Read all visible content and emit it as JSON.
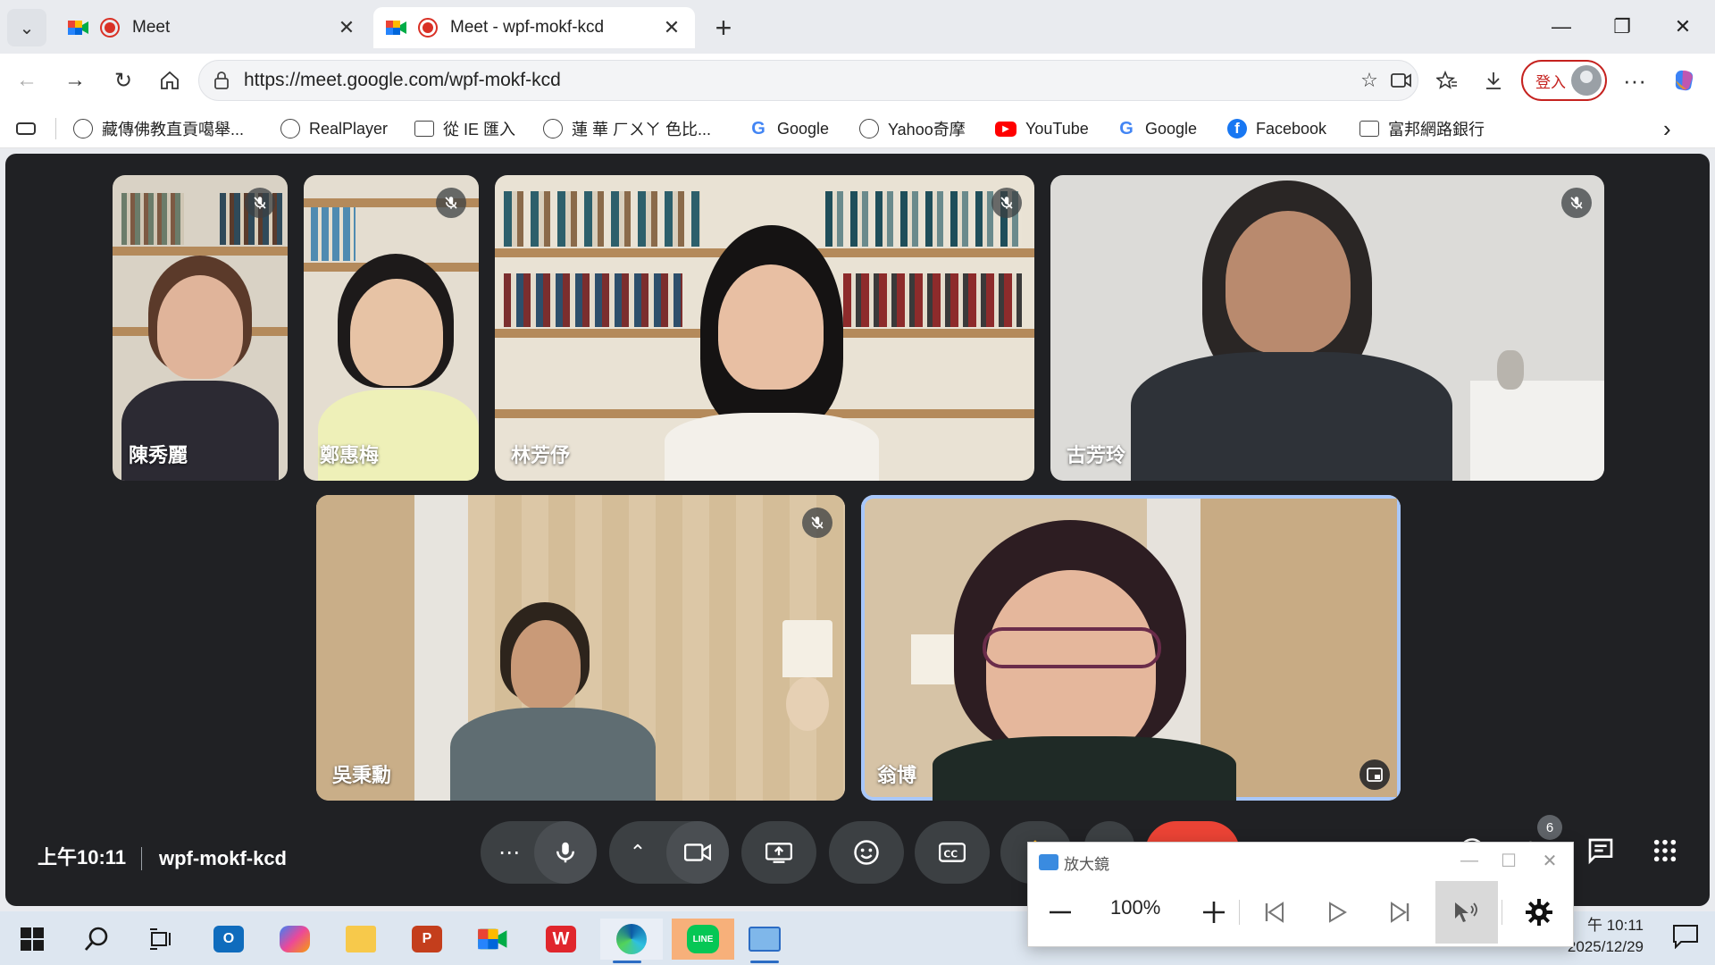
{
  "tabs": [
    {
      "title": "Meet",
      "active": false
    },
    {
      "title": "Meet - wpf-mokf-kcd",
      "active": true
    }
  ],
  "address_bar": {
    "url": "https://meet.google.com/wpf-mokf-kcd"
  },
  "profile": {
    "login_label": "登入"
  },
  "bookmarks": [
    {
      "label": "藏傳佛教直貢噶舉...",
      "icon": "globe-icon"
    },
    {
      "label": "RealPlayer",
      "icon": "globe-icon"
    },
    {
      "label": "從 IE 匯入",
      "icon": "folder-icon"
    },
    {
      "label": "蓮 華 ㄏㄨㄚ 色比...",
      "icon": "globe-icon"
    },
    {
      "label": "Google",
      "icon": "google-icon"
    },
    {
      "label": "Yahoo奇摩",
      "icon": "globe-icon"
    },
    {
      "label": "YouTube",
      "icon": "youtube-icon"
    },
    {
      "label": "Google",
      "icon": "google-icon"
    },
    {
      "label": "Facebook",
      "icon": "facebook-icon"
    },
    {
      "label": "富邦網路銀行",
      "icon": "folder-icon"
    }
  ],
  "participants": [
    {
      "name": "陳秀麗",
      "muted": true
    },
    {
      "name": "鄭惠梅",
      "muted": true
    },
    {
      "name": "林芳伃",
      "muted": true
    },
    {
      "name": "古芳玲",
      "muted": true
    },
    {
      "name": "吳秉勳",
      "muted": true
    },
    {
      "name": "翁博",
      "muted": false,
      "speaking": true
    }
  ],
  "meeting": {
    "time": "上午10:11",
    "code": "wpf-mokf-kcd",
    "participant_count": "6"
  },
  "magnifier": {
    "title": "放大鏡",
    "zoom": "100%"
  },
  "taskbar": {
    "time": "午 10:11",
    "date": "2025/12/29"
  },
  "colors": {
    "meet_bg": "#202124",
    "control_bg": "#3c4043",
    "end_call": "#ea4335",
    "speaking_border": "#a8c7fa",
    "login_red": "#c5221f"
  }
}
